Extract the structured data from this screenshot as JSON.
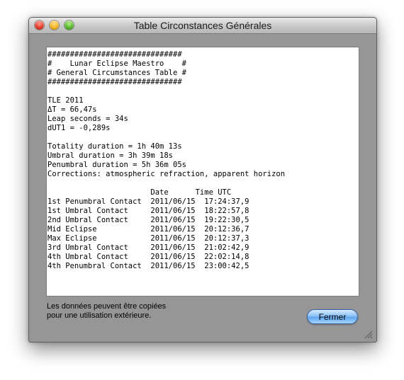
{
  "window": {
    "title": "Table Circonstances Générales"
  },
  "table_text": "##############################\n#    Lunar Eclipse Maestro    #\n# General Circumstances Table #\n##############################\n\nTLE 2011\nΔT = 66,47s\nLeap seconds = 34s\ndUT1 = -0,289s\n\nTotality duration = 1h 40m 13s\nUmbral duration = 3h 39m 18s\nPenumbral duration = 5h 36m 05s\nCorrections: atmospheric refraction, apparent horizon\n\n                       Date      Time UTC\n1st Penumbral Contact  2011/06/15  17:24:37,9\n1st Umbral Contact     2011/06/15  18:22:57,8\n2nd Umbral Contact     2011/06/15  19:22:30,5\nMid Eclipse            2011/06/15  20:12:36,7\nMax Eclipse            2011/06/15  20:12:37,3\n3rd Umbral Contact     2011/06/15  21:02:42,9\n4th Umbral Contact     2011/06/15  22:02:14,8\n4th Penumbral Contact  2011/06/15  23:00:42,5",
  "footer": {
    "note": "Les données peuvent être copiées\npour une utilisation extérieure.",
    "close_button": "Fermer"
  }
}
